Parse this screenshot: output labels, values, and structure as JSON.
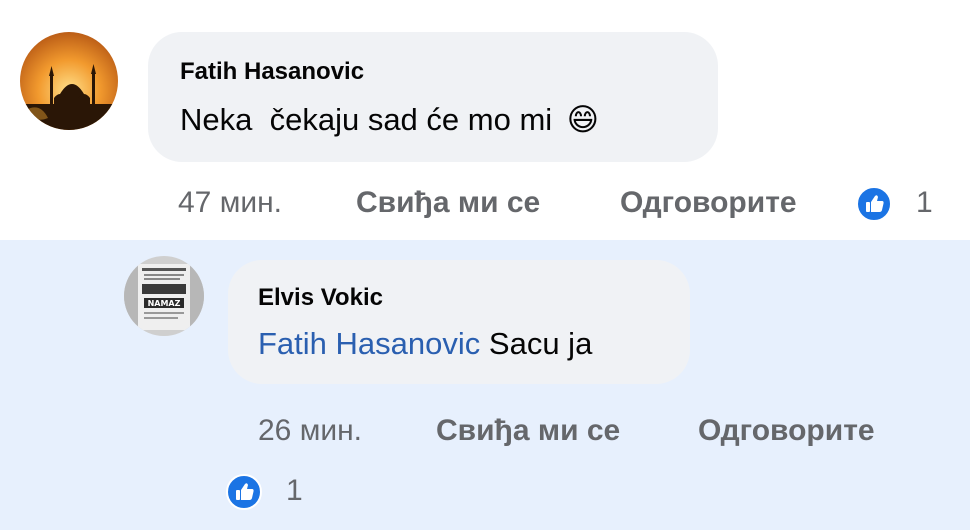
{
  "colors": {
    "reply_highlight": "#e7f0fd",
    "bubble": "#f0f2f5",
    "mention": "#2a5fb0",
    "like": "#1b74e4",
    "meta": "#65676b"
  },
  "comments": [
    {
      "author": "Fatih Hasanovic",
      "avatar_icon": "mosque-sunset-avatar",
      "text": "Neka  čekaju sad će mo mi",
      "emoji": "😄",
      "time": "47 мин.",
      "like_label": "Свиђа ми се",
      "reply_label": "Одговорите",
      "reaction_icon": "thumbs-up-icon",
      "reaction_count": "1"
    },
    {
      "author": "Elvis Vokic",
      "avatar_icon": "namaz-poster-avatar",
      "mention": "Fatih Hasanovic",
      "text": "Sacu ja",
      "time": "26 мин.",
      "like_label": "Свиђа ми се",
      "reply_label": "Одговорите",
      "reaction_icon": "thumbs-up-icon",
      "reaction_count": "1"
    }
  ]
}
